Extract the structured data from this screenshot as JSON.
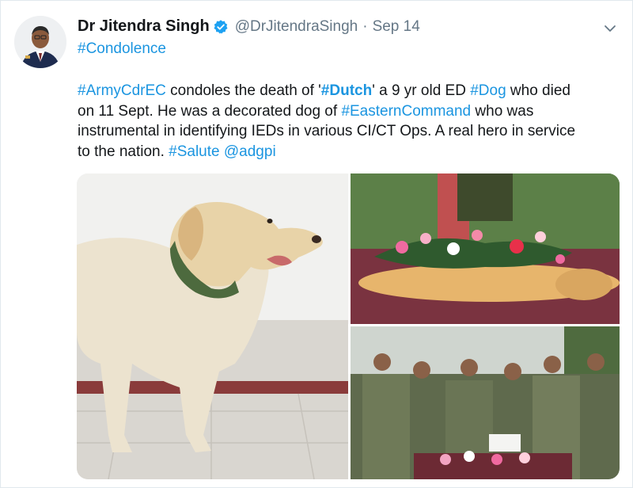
{
  "author": {
    "name": "Dr Jitendra Singh",
    "handle": "@DrJitendraSingh",
    "separator": "·",
    "date": "Sep 14"
  },
  "hashtag_line": "#Condolence",
  "text": {
    "l1_a": "#ArmyCdrEC",
    "l1_b": " condoles the death of '",
    "l1_c": "#Dutch",
    "l1_d": "' a 9 yr old ED ",
    "l1_e": "#Dog",
    "l1_f": " who died",
    "l2_a": "on 11 Sept. He was a  decorated dog of ",
    "l2_b": "#EasternCommand",
    "l2_c": " who was",
    "l3": "instrumental in identifying IEDs in various CI/CT Ops.  A real hero in service",
    "l4_a": "to the nation. ",
    "l4_b": "#Salute",
    "l4_c": " ",
    "l4_d": "@adgpi"
  },
  "colors": {
    "link": "#1b95e0",
    "muted": "#657786",
    "verified": "#1da1f2"
  },
  "icons": [
    "verified-badge-icon",
    "chevron-down-icon"
  ]
}
